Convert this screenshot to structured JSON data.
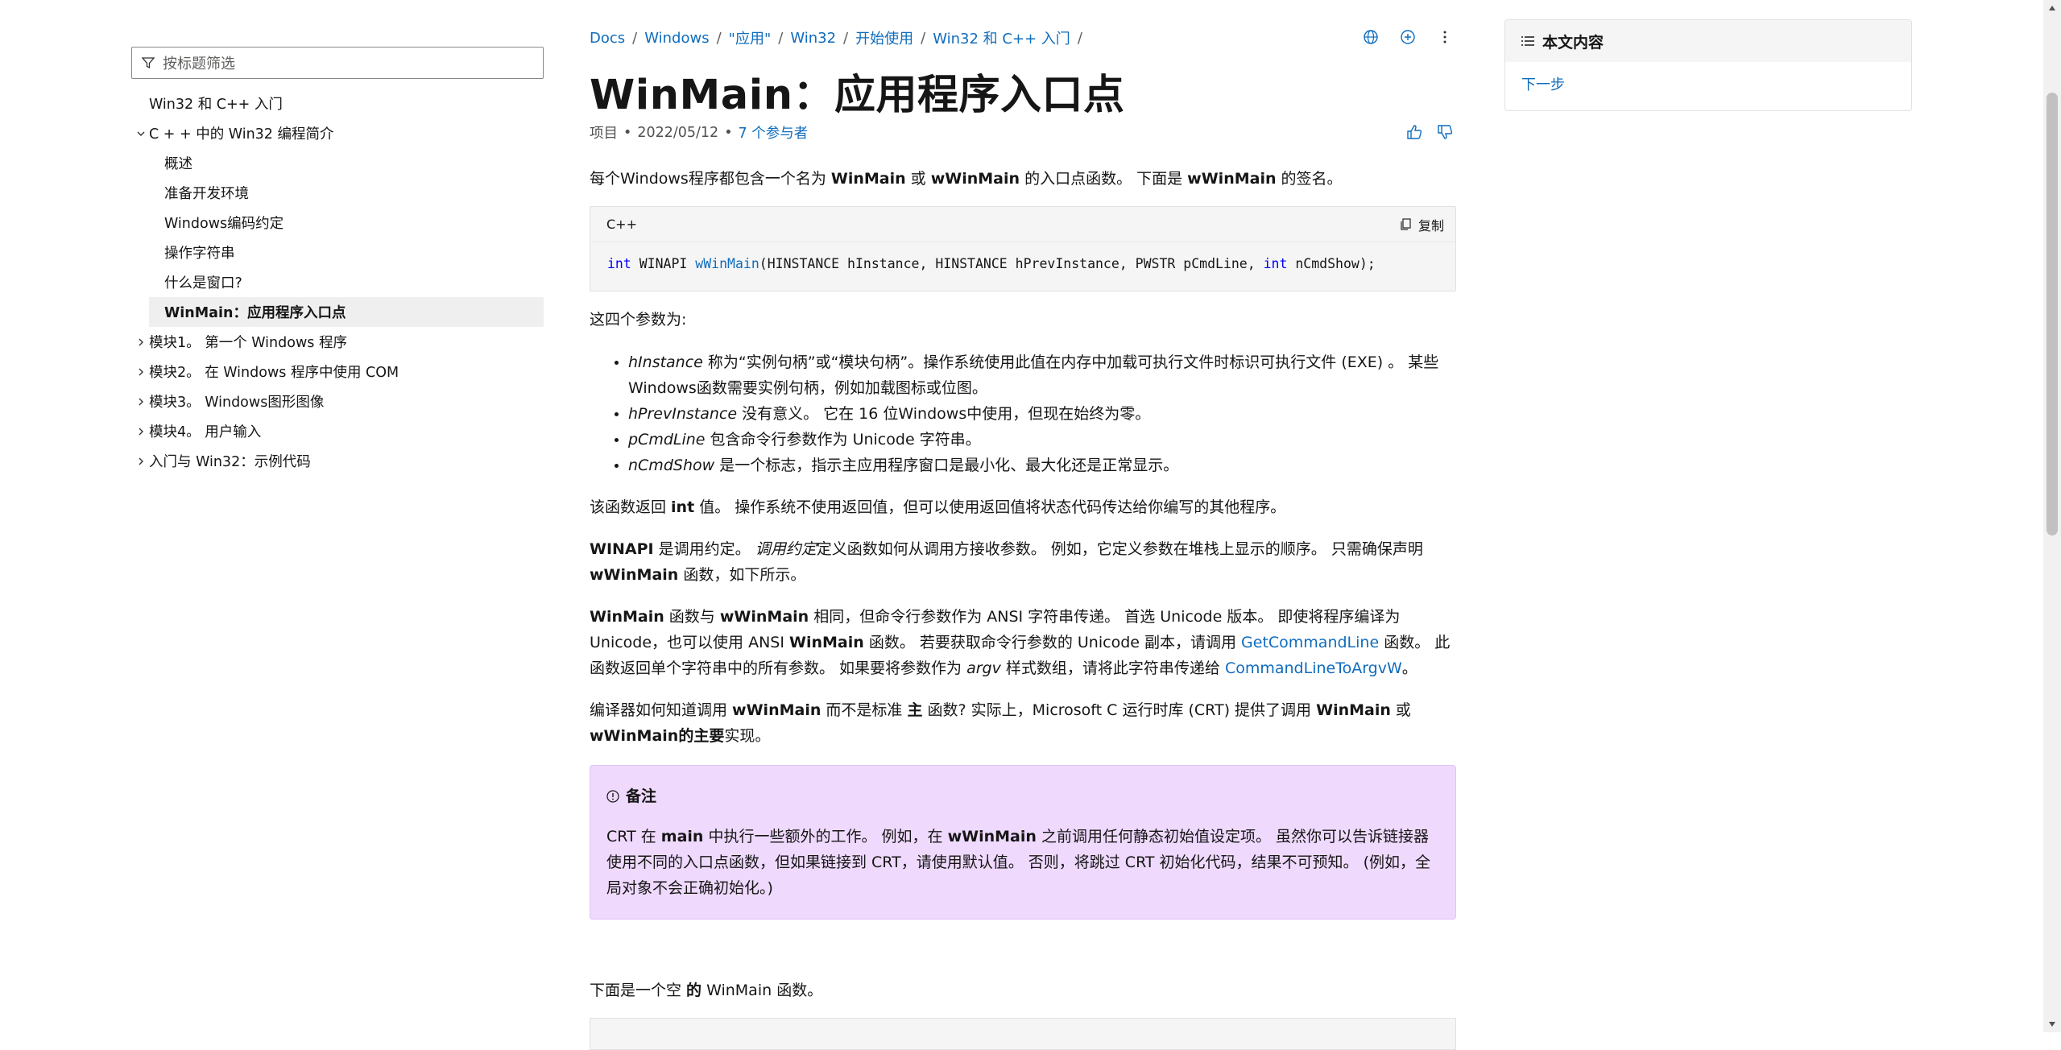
{
  "left_nav": {
    "filter_placeholder": "按标题筛选",
    "items": [
      {
        "label": "Win32 和 C++ 入门"
      },
      {
        "label": "C + + 中的 Win32 编程简介"
      },
      {
        "label": "概述"
      },
      {
        "label": "准备开发环境"
      },
      {
        "label": "Windows编码约定"
      },
      {
        "label": "操作字符串"
      },
      {
        "label": "什么是窗口?"
      },
      {
        "label": "WinMain：应用程序入口点"
      },
      {
        "label": "模块1。 第一个 Windows 程序"
      },
      {
        "label": "模块2。 在 Windows 程序中使用 COM"
      },
      {
        "label": "模块3。 Windows图形图像"
      },
      {
        "label": "模块4。 用户输入"
      },
      {
        "label": "入门与 Win32：示例代码"
      }
    ]
  },
  "breadcrumb": [
    "Docs",
    "Windows",
    "\"应用\"",
    "Win32",
    "开始使用",
    "Win32 和 C++ 入门"
  ],
  "breadcrumb_sep": "/",
  "title": "WinMain：应用程序入口点",
  "meta": {
    "kind": "项目",
    "dot": "•",
    "date": "2022/05/12",
    "contributors": "7 个参与者"
  },
  "intro": {
    "p1": "每个Windows程序都包含一个名为 ",
    "b1": "WinMain",
    "p2": " 或 ",
    "b2": "wWinMain",
    "p3": " 的入口点函数。 下面是 ",
    "b3": "wWinMain",
    "p4": " 的签名。"
  },
  "code1": {
    "lang": "C++",
    "copy_label": "复制",
    "t1": "int",
    "t2": " WINAPI ",
    "t3": "wWinMain",
    "t4": "(HINSTANCE hInstance, HINSTANCE hPrevInstance, PWSTR pCmdLine, ",
    "t5": "int",
    "t6": " nCmdShow);"
  },
  "params_heading": "这四个参数为:",
  "params": [
    {
      "name": "hInstance",
      "text": " 称为“实例句柄”或“模块句柄”。操作系统使用此值在内存中加载可执行文件时标识可执行文件 (EXE) 。 某些Windows函数需要实例句柄，例如加载图标或位图。"
    },
    {
      "name": "hPrevInstance",
      "text": " 没有意义。 它在 16 位Windows中使用，但现在始终为零。"
    },
    {
      "name": "pCmdLine",
      "text": " 包含命令行参数作为 Unicode 字符串。"
    },
    {
      "name": "nCmdShow",
      "text": " 是一个标志，指示主应用程序窗口是最小化、最大化还是正常显示。"
    }
  ],
  "return_p": {
    "a": "该函数返回 ",
    "b": "int",
    "c": " 值。 操作系统不使用返回值，但可以使用返回值将状态代码传达给你编写的其他程序。"
  },
  "winapi_p": {
    "a": "WINAPI",
    "b": " 是调用约定。 ",
    "c": "调用约定",
    "d": "定义函数如何从调用方接收参数。 例如，它定义参数在堆栈上显示的顺序。 只需确保声明 ",
    "e": "wWinMain",
    "f": " 函数，如下所示。"
  },
  "wwinmain_p": {
    "a": "WinMain",
    "b": " 函数与 ",
    "c": "wWinMain",
    "d": " 相同，但命令行参数作为 ANSI 字符串传递。 首选 Unicode 版本。 即使将程序编译为 Unicode，也可以使用 ANSI ",
    "e": "WinMain",
    "f": " 函数。 若要获取命令行参数的 Unicode 副本，请调用 ",
    "g": "GetCommandLine",
    "h": " 函数。 此函数返回单个字符串中的所有参数。 如果要将参数作为 ",
    "i": "argv",
    "j": " 样式数组，请将此字符串传递给 ",
    "k": "CommandLineToArgvW",
    "l": "。"
  },
  "compiler_p": {
    "a": "编译器如何知道调用 ",
    "b": "wWinMain",
    "c": " 而不是标准 ",
    "d": "主",
    "e": " 函数? 实际上，Microsoft C 运行时库 (CRT) 提供了调用 ",
    "f": "WinMain",
    "g": " 或 ",
    "h": "wWinMain的主要",
    "i": "实现。"
  },
  "note": {
    "title": "备注",
    "a": "CRT 在 ",
    "b": "main",
    "c": " 中执行一些额外的工作。 例如，在 ",
    "d": "wWinMain",
    "e": " 之前调用任何静态初始值设定项。 虽然你可以告诉链接器使用不同的入口点函数，但如果链接到 CRT，请使用默认值。 否则，将跳过 CRT 初始化代码，结果不可预知。 (例如，全局对象不会正确初始化。)"
  },
  "empty_p": {
    "a": "下面是一个空 ",
    "b": "的",
    "c": " WinMain",
    "d": " 函数。"
  },
  "right_panel": {
    "title": "本文内容",
    "link": "下一步"
  },
  "colors": {
    "link": "#0f6cbd",
    "note_bg": "#efd9fd",
    "code_bg": "#f5f5f5"
  }
}
